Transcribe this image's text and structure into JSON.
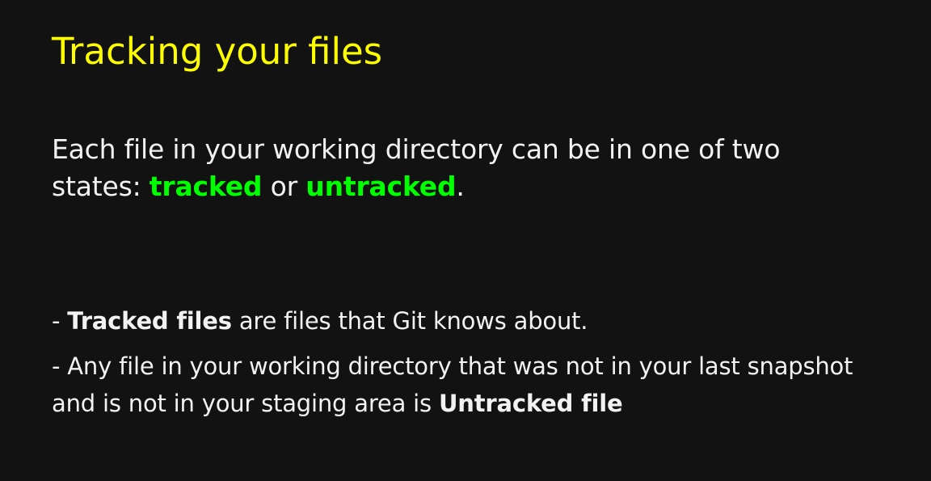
{
  "slide": {
    "title": "Tracking your files",
    "intro": {
      "before": "Each file in your working directory can be in one of two states: ",
      "tracked": "tracked",
      "middle": " or ",
      "untracked": "untracked",
      "after": "."
    },
    "bullets": [
      {
        "prefix": "- ",
        "bold": "Tracked files",
        "rest": " are files that Git knows about."
      },
      {
        "prefix": "-  ",
        "text": "Any file in your working directory that was not in your last snapshot and is not in your staging area is ",
        "bold": "Untracked file"
      }
    ]
  },
  "colors": {
    "background": "#121212",
    "title": "#ffff00",
    "highlight": "#00ff00",
    "text": "#f2f2f2"
  }
}
